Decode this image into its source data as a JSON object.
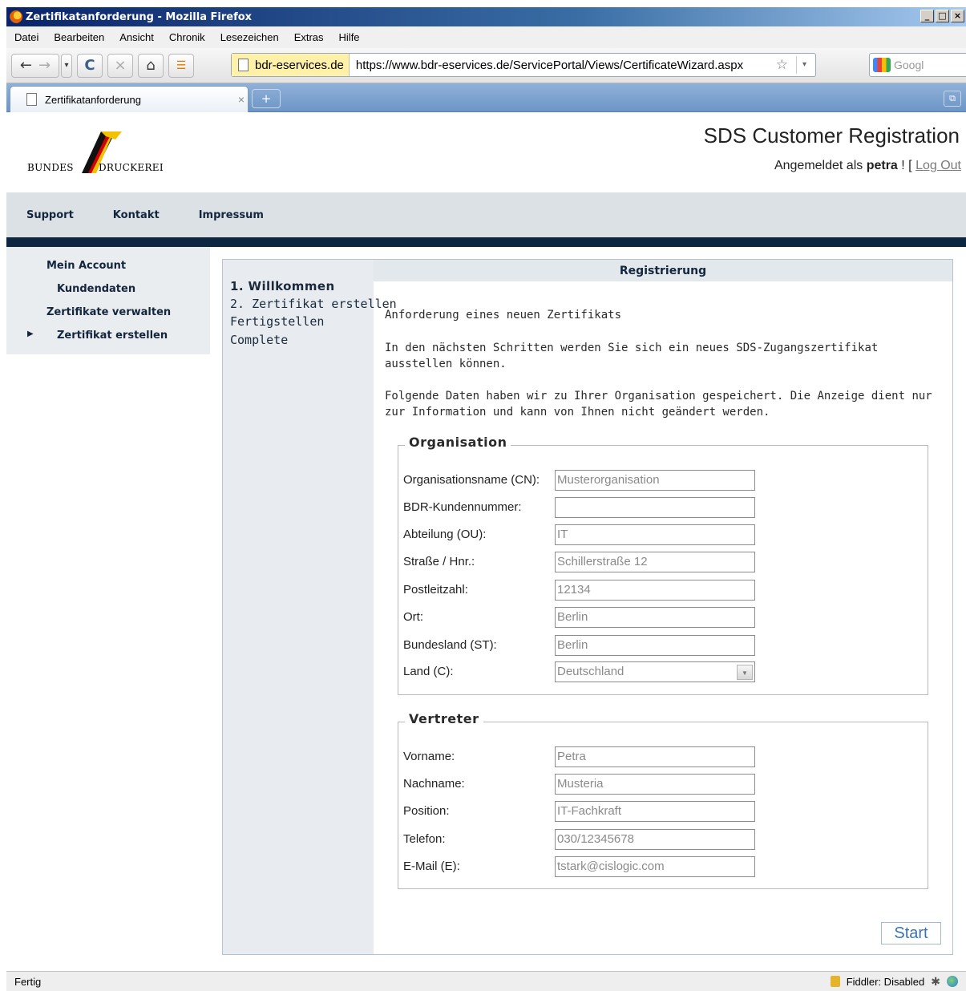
{
  "window": {
    "title": "Zertifikatanforderung - Mozilla Firefox",
    "controls": [
      "_",
      "□",
      "×"
    ]
  },
  "menu": [
    "Datei",
    "Bearbeiten",
    "Ansicht",
    "Chronik",
    "Lesezeichen",
    "Extras",
    "Hilfe"
  ],
  "toolbar": {
    "back": "←",
    "forward": "→",
    "dropdown": "▾",
    "reload": "C",
    "stop": "×",
    "home": "⌂",
    "rss": "☰",
    "identity": "bdr-eservices.de",
    "url": "https://www.bdr-eservices.de/ServicePortal/Views/CertificateWizard.aspx",
    "star": "☆",
    "search_placeholder": "Googl"
  },
  "tabs": [
    {
      "label": "Zertifikatanforderung"
    }
  ],
  "tab_controls": {
    "close": "×",
    "new_tab": "+",
    "tab_list": "⧉"
  },
  "header": {
    "logo_left": "BUNDES",
    "logo_right": "DRUCKEREI",
    "site_title": "SDS Customer Registration",
    "login_prefix": "Angemeldet als",
    "username": "petra",
    "login_mid": " ! [ ",
    "logout": "Log Out"
  },
  "topnav": [
    "Support",
    "Kontakt",
    "Impressum"
  ],
  "sidebar": {
    "my_account": "Mein Account",
    "customer_data": "Kundendaten",
    "manage_certs": "Zertifikate verwalten",
    "create_cert": "Zertifikat erstellen",
    "marker": "▶"
  },
  "wizard": {
    "steps": [
      "1. Willkommen",
      "2. Zertifikat erstellen",
      "Fertigstellen",
      "Complete"
    ],
    "heading": "Registrierung",
    "intro_title": "Anforderung eines neuen Zertifikats",
    "intro_text1": "In den nächsten Schritten werden Sie sich ein neues SDS-Zugangszertifikat ausstellen können.",
    "intro_text2": "Folgende Daten haben wir zu Ihrer Organisation gespeichert. Die Anzeige dient nur zur Information und kann von Ihnen nicht geändert werden.",
    "organisation": {
      "legend": "Organisation",
      "fields": [
        {
          "label": "Organisationsname (CN):",
          "value": "Musterorganisation"
        },
        {
          "label": "BDR-Kundennummer:",
          "value": ""
        },
        {
          "label": "Abteilung (OU):",
          "value": "IT"
        },
        {
          "label": "Straße / Hnr.:",
          "value": "Schillerstraße 12"
        },
        {
          "label": "Postleitzahl:",
          "value": "12134"
        },
        {
          "label": "Ort:",
          "value": "Berlin"
        },
        {
          "label": "Bundesland (ST):",
          "value": "Berlin"
        },
        {
          "label": "Land (C):",
          "value": "Deutschland"
        }
      ]
    },
    "vertreter": {
      "legend": "Vertreter",
      "fields": [
        {
          "label": "Vorname:",
          "value": "Petra"
        },
        {
          "label": "Nachname:",
          "value": "Musteria"
        },
        {
          "label": "Position:",
          "value": "IT-Fachkraft"
        },
        {
          "label": "Telefon:",
          "value": "030/12345678"
        },
        {
          "label": "E-Mail (E):",
          "value": "tstark@cislogic.com"
        }
      ]
    },
    "start_label": "Start"
  },
  "status": {
    "left": "Fertig",
    "fiddler": "Fiddler: Disabled"
  },
  "colors": {
    "accent_dark": "#0e2740",
    "nav_bg": "#dce1e6",
    "link_blue": "#3b73b0"
  }
}
